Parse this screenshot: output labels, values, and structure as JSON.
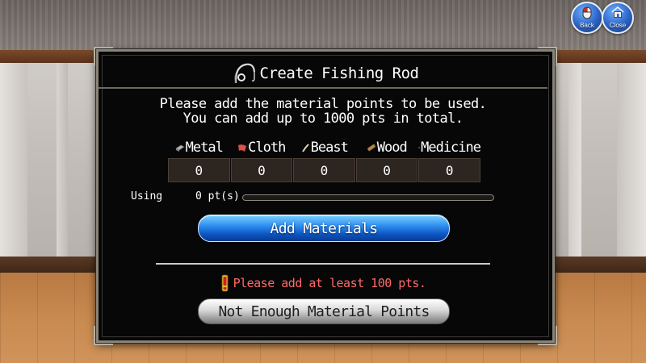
{
  "window": {
    "back_label": "Back",
    "close_label": "Close"
  },
  "dialog": {
    "title": "Create Fishing Rod",
    "title_icon": "fishing-rod-icon",
    "intro_line1": "Please add the material points to be used.",
    "intro_line2": "You can add up to 1000 pts in total.",
    "materials": [
      {
        "name": "Metal",
        "value": "0",
        "icon": "metal-icon"
      },
      {
        "name": "Cloth",
        "value": "0",
        "icon": "cloth-icon"
      },
      {
        "name": "Beast",
        "value": "0",
        "icon": "beast-icon"
      },
      {
        "name": "Wood",
        "value": "0",
        "icon": "wood-icon"
      },
      {
        "name": "Medicine",
        "value": "0",
        "icon": "medicine-icon"
      }
    ],
    "using_label": "Using",
    "using_value": "0 pt(s)",
    "using_progress": 0,
    "add_button_label": "Add Materials",
    "warning_text": "Please add at least 100 pts.",
    "not_enough_button_label": "Not Enough Material Points"
  },
  "colors": {
    "accent_blue": "#2f8ff0",
    "warning_red": "#ff6a6a",
    "dialog_bg": "#070707"
  }
}
